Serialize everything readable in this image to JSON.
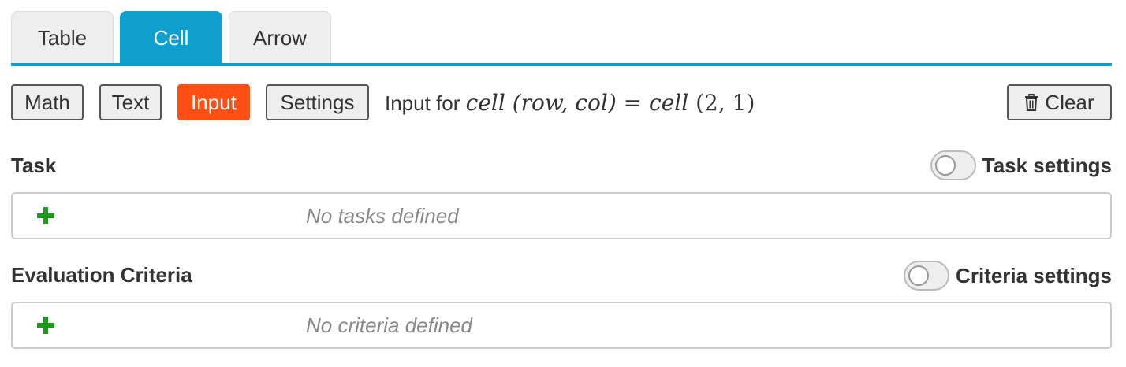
{
  "tabs": [
    {
      "label": "Table",
      "active": false
    },
    {
      "label": "Cell",
      "active": true
    },
    {
      "label": "Arrow",
      "active": false
    }
  ],
  "toolbar": {
    "buttons": [
      {
        "label": "Math",
        "active": false
      },
      {
        "label": "Text",
        "active": false
      },
      {
        "label": "Input",
        "active": true
      },
      {
        "label": "Settings",
        "active": false
      }
    ],
    "info_prefix": "Input for",
    "info_math_left": "cell",
    "info_math_args": "(row, col)",
    "info_math_eq": "=",
    "info_math_right": "cell",
    "info_math_values": "(2, 1)",
    "clear_label": "Clear"
  },
  "task": {
    "title": "Task",
    "toggle_label": "Task settings",
    "toggle_on": false,
    "empty_message": "No tasks defined"
  },
  "criteria": {
    "title": "Evaluation Criteria",
    "toggle_label": "Criteria settings",
    "toggle_on": false,
    "empty_message": "No criteria defined"
  },
  "colors": {
    "tab_active": "#0e9fcf",
    "button_active": "#ff4f12",
    "add_icon": "#1b9a1b"
  },
  "icons": {
    "add": "plus-icon",
    "clear": "trash-icon"
  }
}
